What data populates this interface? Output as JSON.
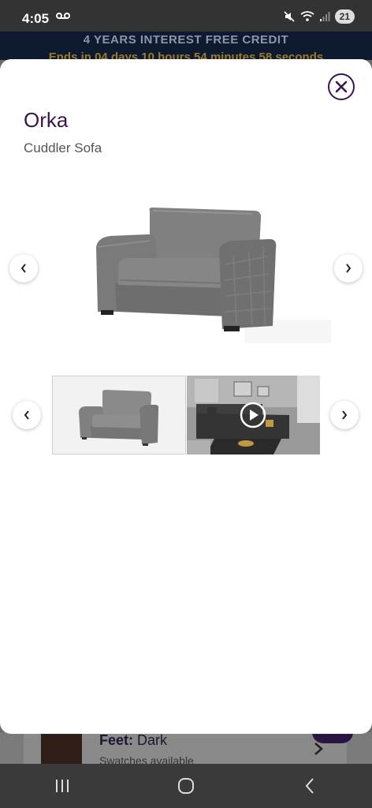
{
  "status_bar": {
    "time": "4:05",
    "battery": "21"
  },
  "promo": {
    "title": "4 YEARS INTEREST FREE CREDIT",
    "countdown": "Ends in 04 days 10 hours 54 minutes 58 seconds"
  },
  "background_page": {
    "feet_label": "Feet:",
    "feet_value": "Dark",
    "subtext": "Swatches available"
  },
  "modal": {
    "product_name": "Orka",
    "product_type": "Cuddler Sofa"
  },
  "gallery": {
    "thumbnails": [
      {
        "type": "image",
        "icon": "armchair"
      },
      {
        "type": "video",
        "icon": "play-icon"
      }
    ]
  },
  "colors": {
    "brand_purple": "#3a1550",
    "promo_bg": "#0e1a30",
    "sofa_grey": "#7a7a7a"
  }
}
